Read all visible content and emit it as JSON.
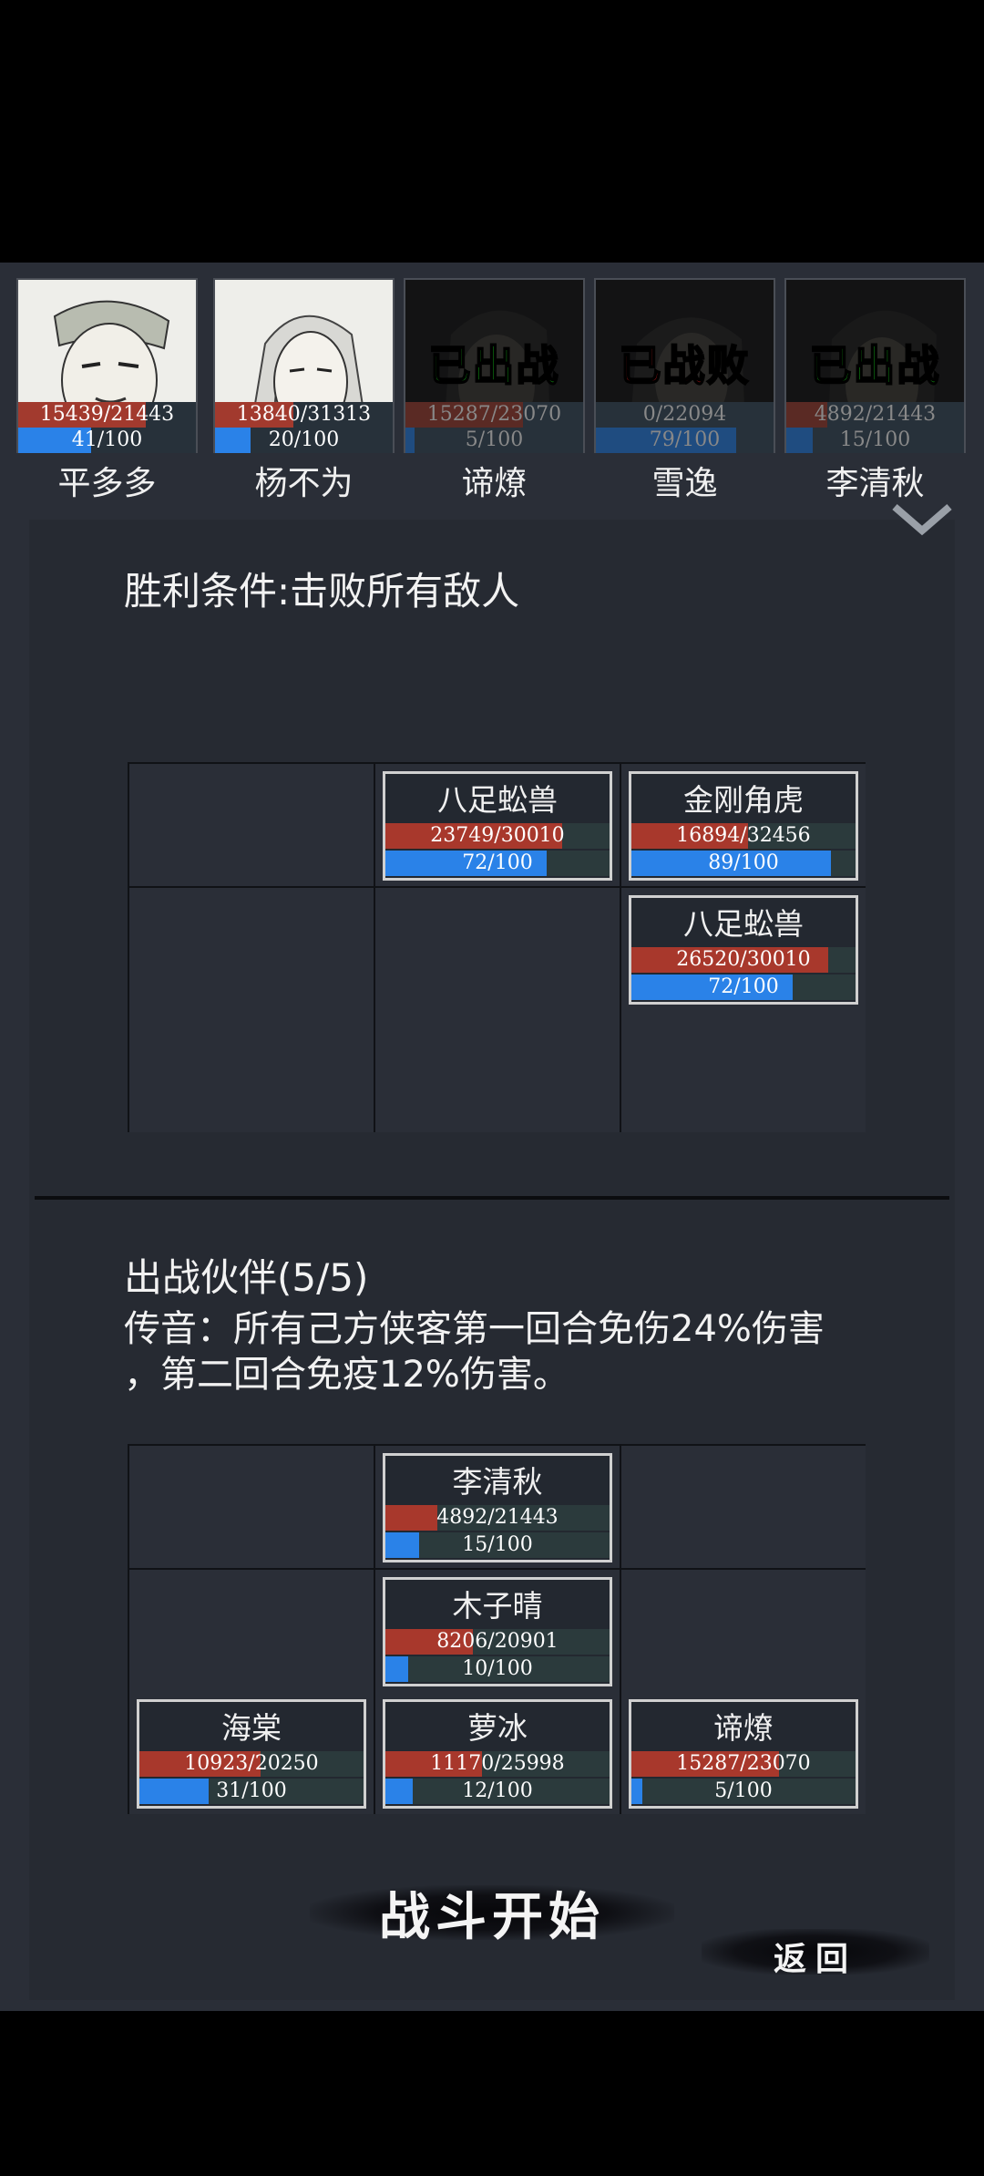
{
  "roster": [
    {
      "name": "平多多",
      "hp": "15439/21443",
      "hp_frac": 0.72,
      "mp": "41/100",
      "mp_frac": 0.41,
      "status": "",
      "status_color": ""
    },
    {
      "name": "杨不为",
      "hp": "13840/31313",
      "hp_frac": 0.44,
      "mp": "20/100",
      "mp_frac": 0.2,
      "status": "",
      "status_color": ""
    },
    {
      "name": "谛燎",
      "hp": "15287/23070",
      "hp_frac": 0.66,
      "mp": "5/100",
      "mp_frac": 0.05,
      "status": "已出战",
      "status_color": "green"
    },
    {
      "name": "雪逸",
      "hp": "0/22094",
      "hp_frac": 0.0,
      "mp": "79/100",
      "mp_frac": 0.79,
      "status": "已战败",
      "status_color": "red"
    },
    {
      "name": "李清秋",
      "hp": "4892/21443",
      "hp_frac": 0.23,
      "mp": "15/100",
      "mp_frac": 0.15,
      "status": "已出战",
      "status_color": "green"
    }
  ],
  "victory": {
    "title": "胜利条件:击败所有敌人"
  },
  "enemy_grid": [
    {
      "row": 0,
      "col": 1,
      "name": "八足蚣兽",
      "hp": "23749/30010",
      "hp_frac": 0.79,
      "mp": "72/100",
      "mp_frac": 0.72
    },
    {
      "row": 0,
      "col": 2,
      "name": "金刚角虎",
      "hp": "16894/32456",
      "hp_frac": 0.52,
      "mp": "89/100",
      "mp_frac": 0.89
    },
    {
      "row": 1,
      "col": 2,
      "name": "八足蚣兽",
      "hp": "26520/30010",
      "hp_frac": 0.88,
      "mp": "72/100",
      "mp_frac": 0.72
    }
  ],
  "partners": {
    "title": "出战伙伴(5/5)",
    "desc_line1": "传音：所有己方侠客第一回合免伤24%伤害",
    "desc_line2": "，第二回合免疫12%伤害。"
  },
  "ally_grid": [
    {
      "row": 0,
      "col": 1,
      "name": "李清秋",
      "hp": "4892/21443",
      "hp_frac": 0.23,
      "mp": "15/100",
      "mp_frac": 0.15
    },
    {
      "row": 1,
      "col": 1,
      "name": "木子晴",
      "hp": "8206/20901",
      "hp_frac": 0.39,
      "mp": "10/100",
      "mp_frac": 0.1
    },
    {
      "row": 2,
      "col": 0,
      "name": "海棠",
      "hp": "10923/20250",
      "hp_frac": 0.54,
      "mp": "31/100",
      "mp_frac": 0.31
    },
    {
      "row": 2,
      "col": 1,
      "name": "萝冰",
      "hp": "11170/25998",
      "hp_frac": 0.43,
      "mp": "12/100",
      "mp_frac": 0.12
    },
    {
      "row": 2,
      "col": 2,
      "name": "谛燎",
      "hp": "15287/23070",
      "hp_frac": 0.66,
      "mp": "5/100",
      "mp_frac": 0.05
    }
  ],
  "buttons": {
    "start": "战斗开始",
    "back": "返回"
  }
}
